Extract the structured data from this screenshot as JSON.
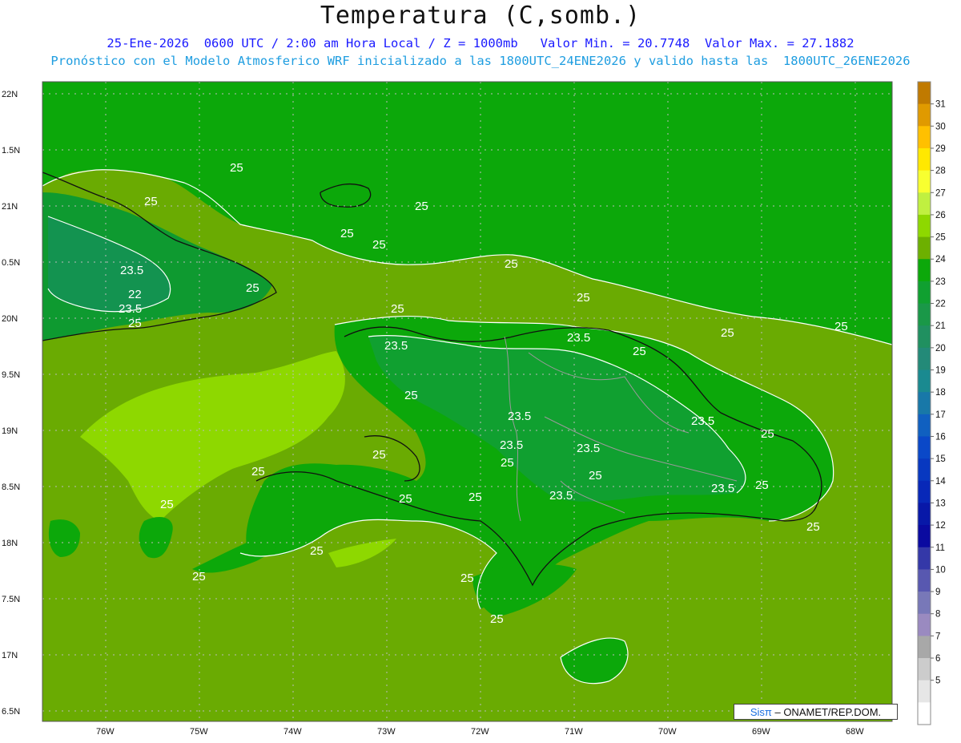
{
  "title": "Temperatura (C,somb.)",
  "subtitle_line1": "25-Ene-2026  0600 UTC / 2:00 am Hora Local / Z = 1000mb   Valor Min. = 20.7748  Valor Max. = 27.1882",
  "subtitle_line2": "Pronóstico con el Modelo Atmosferico WRF inicializado a las 1800UTC_24ENE2026 y valido hasta las  1800UTC_26ENE2026",
  "credit": {
    "brand": "Sisπ",
    "text": " – ONAMET/REP.DOM."
  },
  "axes": {
    "lat_labels": [
      "22N",
      "1.5N",
      "21N",
      "0.5N",
      "20N",
      "9.5N",
      "19N",
      "8.5N",
      "18N",
      "7.5N",
      "17N",
      "6.5N"
    ],
    "lon_labels": [
      "76W",
      "75W",
      "74W",
      "73W",
      "72W",
      "71W",
      "70W",
      "69W",
      "68W"
    ]
  },
  "colorbar": {
    "labels": [
      "31",
      "30",
      "29",
      "28",
      "27",
      "26",
      "25",
      "24",
      "23",
      "22",
      "21",
      "20",
      "19",
      "18",
      "17",
      "16",
      "15",
      "14",
      "13",
      "12",
      "11",
      "10",
      "9",
      "8",
      "7",
      "6",
      "5"
    ],
    "colors": [
      "#c07a00",
      "#e09a00",
      "#ffc000",
      "#ffe800",
      "#f8ff30",
      "#c0f040",
      "#8ed800",
      "#6db000",
      "#0ca80a",
      "#10a030",
      "#1a9848",
      "#209060",
      "#238a78",
      "#1a8a90",
      "#1878a8",
      "#1060c0",
      "#0a48c8",
      "#0838c0",
      "#0828b8",
      "#0818a8",
      "#0a0aa0",
      "#3438a8",
      "#5858b0",
      "#7878b8",
      "#9a8ac0",
      "#a8a8a8",
      "#cccccc",
      "#e6e6e6",
      "#ffffff"
    ]
  },
  "contour_labels": [
    {
      "text": "25"
    },
    {
      "text": "25"
    },
    {
      "text": "25"
    },
    {
      "text": "25"
    },
    {
      "text": "25"
    },
    {
      "text": "23.5"
    },
    {
      "text": "22"
    },
    {
      "text": "23.5"
    },
    {
      "text": "25"
    },
    {
      "text": "25"
    },
    {
      "text": "25"
    },
    {
      "text": "25"
    },
    {
      "text": "23.5"
    },
    {
      "text": "23.5"
    },
    {
      "text": "25"
    },
    {
      "text": "25"
    },
    {
      "text": "23.5"
    },
    {
      "text": "23.5"
    },
    {
      "text": "25"
    },
    {
      "text": "25"
    },
    {
      "text": "23.5"
    },
    {
      "text": "23.5"
    },
    {
      "text": "25"
    },
    {
      "text": "25"
    },
    {
      "text": "25"
    },
    {
      "text": "25"
    },
    {
      "text": "25"
    },
    {
      "text": "23.5"
    },
    {
      "text": "23.5"
    },
    {
      "text": "25"
    },
    {
      "text": "25"
    },
    {
      "text": "25"
    },
    {
      "text": "25"
    },
    {
      "text": "25"
    },
    {
      "text": "25"
    },
    {
      "text": "25"
    },
    {
      "text": "25"
    },
    {
      "text": "25"
    },
    {
      "text": "25"
    }
  ]
}
